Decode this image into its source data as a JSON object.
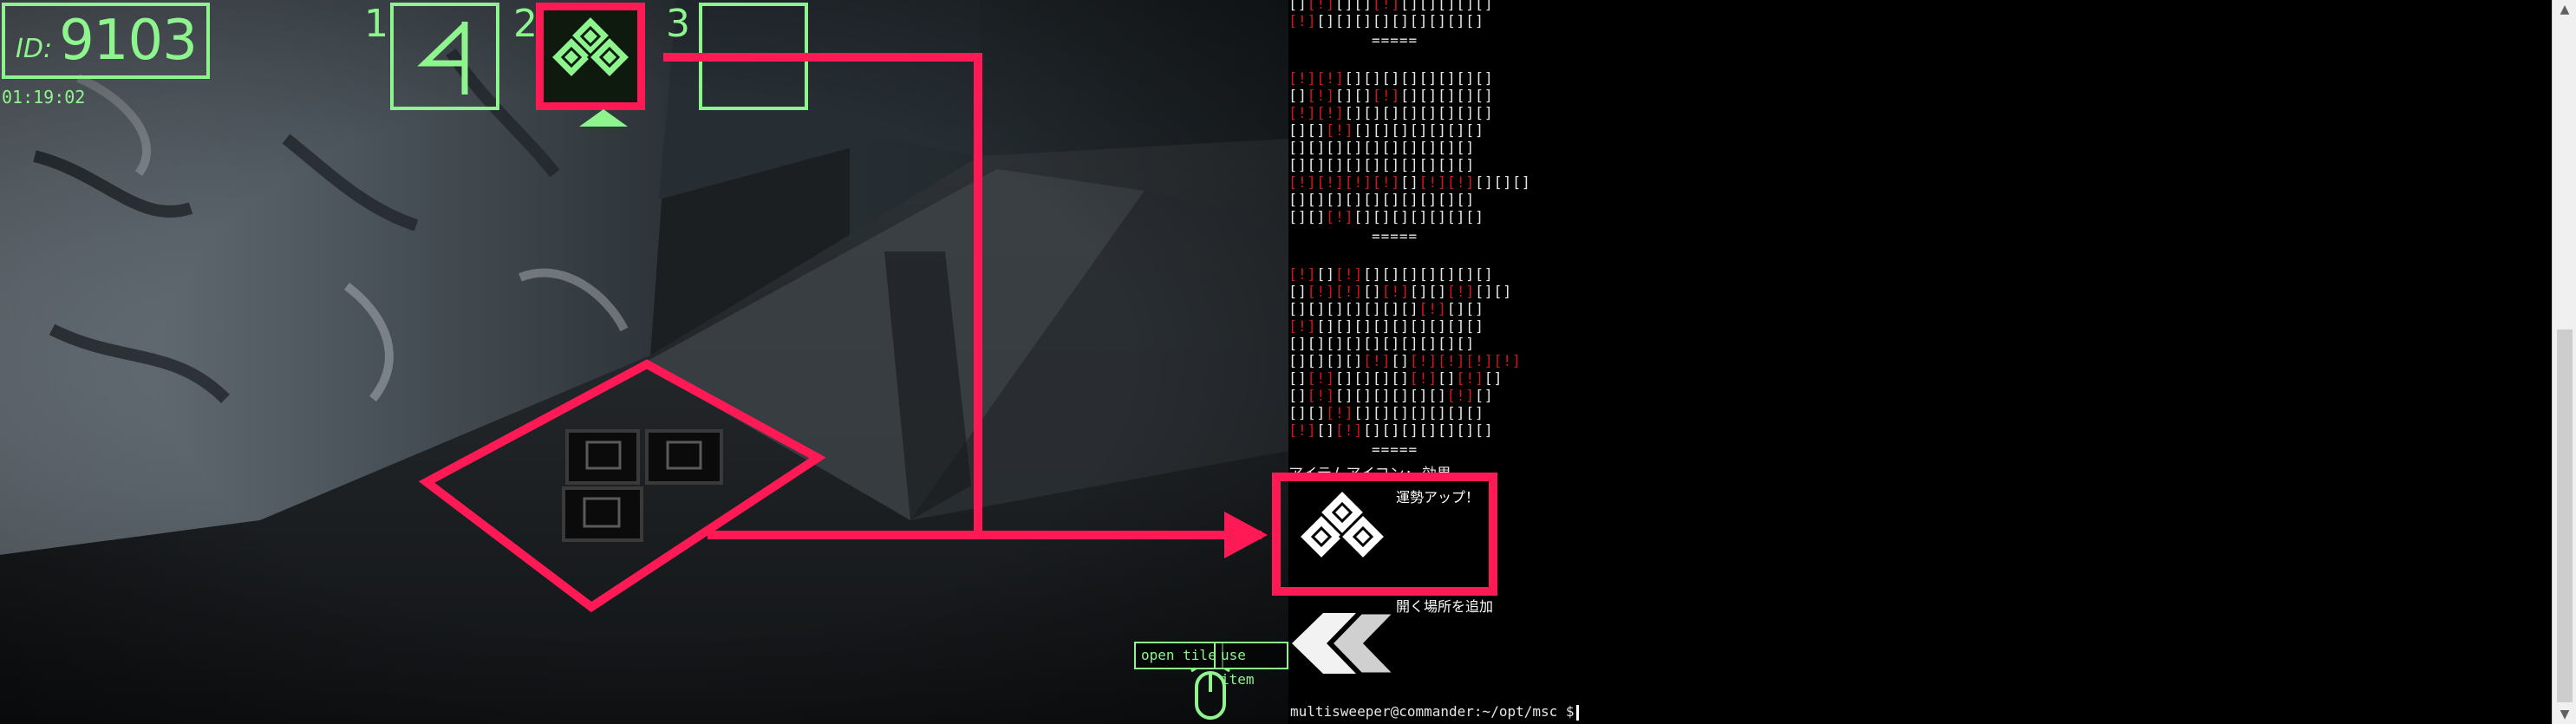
{
  "hud": {
    "id_label": "ID:",
    "id_value": "9103",
    "time": "01:19:02",
    "slot_numbers": [
      "1",
      "2",
      "3"
    ],
    "slot_icons": [
      "flag-icon",
      "diamond-stack-icon",
      ""
    ],
    "selected_slot": 2,
    "hints": {
      "open": "open tile",
      "use": "use item"
    }
  },
  "terminal": {
    "grids": [
      {
        "rows": [
          [
            0,
            1,
            0,
            0,
            1,
            0,
            0,
            0,
            0,
            0
          ],
          [
            1,
            0,
            0,
            0,
            0,
            0,
            0,
            0,
            0,
            0
          ]
        ],
        "separator": "====="
      },
      {
        "rows": [
          [
            1,
            1,
            0,
            0,
            0,
            0,
            0,
            0,
            0,
            0
          ],
          [
            0,
            1,
            0,
            0,
            1,
            0,
            0,
            0,
            0,
            0
          ],
          [
            1,
            1,
            0,
            0,
            0,
            0,
            0,
            0,
            0,
            0
          ],
          [
            0,
            0,
            1,
            0,
            0,
            0,
            0,
            0,
            0,
            0
          ],
          [
            0,
            0,
            0,
            0,
            0,
            0,
            0,
            0,
            0,
            0
          ],
          [
            0,
            0,
            0,
            0,
            0,
            0,
            0,
            0,
            0,
            0
          ],
          [
            1,
            1,
            1,
            1,
            0,
            1,
            1,
            0,
            0,
            0
          ],
          [
            0,
            0,
            0,
            0,
            0,
            0,
            0,
            0,
            0,
            0
          ],
          [
            0,
            0,
            1,
            0,
            0,
            0,
            0,
            0,
            0,
            0
          ]
        ],
        "separator": "====="
      },
      {
        "rows": [
          [
            1,
            0,
            1,
            0,
            0,
            0,
            0,
            0,
            0,
            0
          ],
          [
            0,
            1,
            1,
            0,
            1,
            0,
            0,
            1,
            0,
            0
          ],
          [
            0,
            0,
            0,
            0,
            0,
            0,
            0,
            1,
            0,
            0
          ],
          [
            1,
            0,
            0,
            0,
            0,
            0,
            0,
            0,
            0,
            0
          ],
          [
            0,
            0,
            0,
            0,
            0,
            0,
            0,
            0,
            0,
            0
          ],
          [
            0,
            0,
            0,
            0,
            1,
            0,
            1,
            1,
            1,
            1
          ],
          [
            0,
            1,
            0,
            0,
            0,
            0,
            1,
            0,
            1,
            0
          ],
          [
            0,
            1,
            0,
            0,
            0,
            0,
            0,
            0,
            1,
            0
          ],
          [
            0,
            0,
            1,
            0,
            0,
            0,
            0,
            0,
            0,
            0
          ],
          [
            1,
            0,
            1,
            0,
            0,
            0,
            0,
            0,
            0,
            0
          ]
        ],
        "separator": "====="
      }
    ],
    "item_heading": "アイテムアイコン: 効果",
    "items": [
      {
        "icon": "diamond-stack-icon",
        "effect": "運勢アップ！"
      },
      {
        "icon": "double-chevron-left-icon",
        "effect": "開く場所を追加"
      }
    ],
    "prompt": "multisweeper@commander:~/opt/msc $"
  },
  "colors": {
    "hud_green": "#8ef58e",
    "highlight": "#ff1a55",
    "mine_red": "#d0161d"
  }
}
